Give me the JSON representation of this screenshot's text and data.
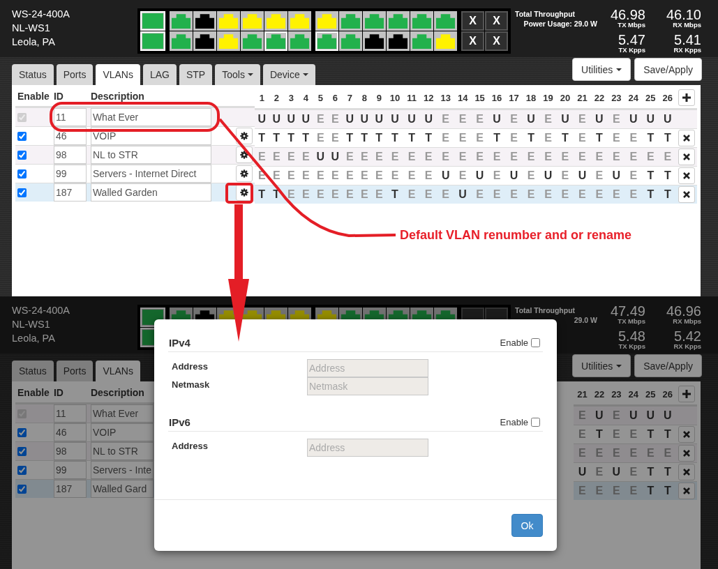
{
  "top": {
    "device": [
      "WS-24-400A",
      "NL-WS1",
      "Leola, PA"
    ],
    "port_panel": {
      "groups": [
        {
          "kind": "sfp",
          "top": [
            {
              "color": "#22b14c",
              "selected": true
            }
          ],
          "bottom": [
            {
              "color": "#22b14c",
              "selected": true
            }
          ]
        },
        {
          "kind": "rj45",
          "top": [
            {
              "color": "#22b14c",
              "selected": false
            },
            {
              "color": "#000000",
              "selected": false
            },
            {
              "color": "#fff200",
              "selected": false
            },
            {
              "color": "#fff200",
              "selected": false
            },
            {
              "color": "#fff200",
              "selected": false
            },
            {
              "color": "#fff200",
              "selected": false
            }
          ],
          "bottom": [
            {
              "color": "#22b14c",
              "selected": false
            },
            {
              "color": "#000000",
              "selected": false
            },
            {
              "color": "#fff200",
              "selected": false
            },
            {
              "color": "#22b14c",
              "selected": false
            },
            {
              "color": "#22b14c",
              "selected": true
            },
            {
              "color": "#22b14c",
              "selected": false
            }
          ]
        },
        {
          "kind": "rj45",
          "top": [
            {
              "color": "#fff200",
              "selected": false
            },
            {
              "color": "#22b14c",
              "selected": false
            },
            {
              "color": "#22b14c",
              "selected": false
            },
            {
              "color": "#22b14c",
              "selected": false
            },
            {
              "color": "#22b14c",
              "selected": false
            },
            {
              "color": "#22b14c",
              "selected": false
            }
          ],
          "bottom": [
            {
              "color": "#22b14c",
              "selected": true
            },
            {
              "color": "#22b14c",
              "selected": false
            },
            {
              "color": "#000000",
              "selected": false
            },
            {
              "color": "#000000",
              "selected": false
            },
            {
              "color": "#22b14c",
              "selected": false
            },
            {
              "color": "#fff200",
              "selected": false
            }
          ]
        }
      ],
      "blanks": [
        "X",
        "X",
        "X",
        "X"
      ]
    },
    "throughput": {
      "title": "Total Throughput",
      "power": "Power Usage: 29.0 W"
    },
    "readings": [
      {
        "value": "46.98",
        "unit": "TX Mbps"
      },
      {
        "value": "46.10",
        "unit": "RX Mbps"
      },
      {
        "value": "5.47",
        "unit": "TX Kpps"
      },
      {
        "value": "5.41",
        "unit": "RX Kpps"
      }
    ],
    "tabs": [
      {
        "label": "Status",
        "selected": false,
        "dropdown": false
      },
      {
        "label": "Ports",
        "selected": false,
        "dropdown": false
      },
      {
        "label": "VLANs",
        "selected": true,
        "dropdown": false
      },
      {
        "label": "LAG",
        "selected": false,
        "dropdown": false
      },
      {
        "label": "STP",
        "selected": false,
        "dropdown": false
      },
      {
        "label": "Tools",
        "selected": false,
        "dropdown": true
      },
      {
        "label": "Device",
        "selected": false,
        "dropdown": true
      }
    ],
    "actions": [
      {
        "label": "Utilities",
        "dropdown": true
      },
      {
        "label": "Save/Apply",
        "dropdown": false
      }
    ],
    "table": {
      "headers": [
        "Enable",
        "ID",
        "Description"
      ],
      "port_columns": [
        "1",
        "2",
        "3",
        "4",
        "5",
        "6",
        "7",
        "8",
        "9",
        "10",
        "11",
        "12",
        "13",
        "14",
        "15",
        "16",
        "17",
        "18",
        "19",
        "20",
        "21",
        "22",
        "23",
        "24",
        "25",
        "26"
      ],
      "rows": [
        {
          "enabled": true,
          "locked": true,
          "settings": false,
          "selected": false,
          "id": "11",
          "description": "What Ever",
          "ports": [
            {
              "mode": "U",
              "active": true
            },
            {
              "mode": "U",
              "active": true
            },
            {
              "mode": "U",
              "active": true
            },
            {
              "mode": "U",
              "active": true
            },
            {
              "mode": "E",
              "active": false
            },
            {
              "mode": "E",
              "active": false
            },
            {
              "mode": "U",
              "active": true
            },
            {
              "mode": "U",
              "active": true
            },
            {
              "mode": "U",
              "active": true
            },
            {
              "mode": "U",
              "active": true
            },
            {
              "mode": "U",
              "active": true
            },
            {
              "mode": "U",
              "active": true
            },
            {
              "mode": "E",
              "active": false
            },
            {
              "mode": "E",
              "active": false
            },
            {
              "mode": "E",
              "active": false
            },
            {
              "mode": "U",
              "active": true
            },
            {
              "mode": "E",
              "active": false
            },
            {
              "mode": "U",
              "active": true
            },
            {
              "mode": "E",
              "active": false
            },
            {
              "mode": "U",
              "active": true
            },
            {
              "mode": "E",
              "active": false
            },
            {
              "mode": "U",
              "active": true
            },
            {
              "mode": "E",
              "active": false
            },
            {
              "mode": "U",
              "active": true
            },
            {
              "mode": "U",
              "active": true
            },
            {
              "mode": "U",
              "active": true
            }
          ]
        },
        {
          "enabled": true,
          "locked": false,
          "settings": true,
          "selected": false,
          "id": "46",
          "description": "VOIP",
          "ports": [
            {
              "mode": "T",
              "active": true
            },
            {
              "mode": "T",
              "active": true
            },
            {
              "mode": "T",
              "active": true
            },
            {
              "mode": "T",
              "active": true
            },
            {
              "mode": "E",
              "active": false
            },
            {
              "mode": "E",
              "active": false
            },
            {
              "mode": "T",
              "active": true
            },
            {
              "mode": "T",
              "active": true
            },
            {
              "mode": "T",
              "active": true
            },
            {
              "mode": "T",
              "active": true
            },
            {
              "mode": "T",
              "active": true
            },
            {
              "mode": "T",
              "active": true
            },
            {
              "mode": "E",
              "active": false
            },
            {
              "mode": "E",
              "active": false
            },
            {
              "mode": "E",
              "active": false
            },
            {
              "mode": "T",
              "active": true
            },
            {
              "mode": "E",
              "active": false
            },
            {
              "mode": "T",
              "active": true
            },
            {
              "mode": "E",
              "active": false
            },
            {
              "mode": "T",
              "active": true
            },
            {
              "mode": "E",
              "active": false
            },
            {
              "mode": "T",
              "active": true
            },
            {
              "mode": "E",
              "active": false
            },
            {
              "mode": "E",
              "active": false
            },
            {
              "mode": "T",
              "active": true
            },
            {
              "mode": "T",
              "active": true
            }
          ]
        },
        {
          "enabled": true,
          "locked": false,
          "settings": true,
          "selected": false,
          "id": "98",
          "description": "NL to STR",
          "ports": [
            {
              "mode": "E",
              "active": false
            },
            {
              "mode": "E",
              "active": false
            },
            {
              "mode": "E",
              "active": false
            },
            {
              "mode": "E",
              "active": false
            },
            {
              "mode": "U",
              "active": true
            },
            {
              "mode": "U",
              "active": true
            },
            {
              "mode": "E",
              "active": false
            },
            {
              "mode": "E",
              "active": false
            },
            {
              "mode": "E",
              "active": false
            },
            {
              "mode": "E",
              "active": false
            },
            {
              "mode": "E",
              "active": false
            },
            {
              "mode": "E",
              "active": false
            },
            {
              "mode": "E",
              "active": false
            },
            {
              "mode": "E",
              "active": false
            },
            {
              "mode": "E",
              "active": false
            },
            {
              "mode": "E",
              "active": false
            },
            {
              "mode": "E",
              "active": false
            },
            {
              "mode": "E",
              "active": false
            },
            {
              "mode": "E",
              "active": false
            },
            {
              "mode": "E",
              "active": false
            },
            {
              "mode": "E",
              "active": false
            },
            {
              "mode": "E",
              "active": false
            },
            {
              "mode": "E",
              "active": false
            },
            {
              "mode": "E",
              "active": false
            },
            {
              "mode": "E",
              "active": false
            },
            {
              "mode": "E",
              "active": false
            }
          ]
        },
        {
          "enabled": true,
          "locked": false,
          "settings": true,
          "selected": false,
          "id": "99",
          "description": "Servers - Internet Direct",
          "ports": [
            {
              "mode": "E",
              "active": false
            },
            {
              "mode": "E",
              "active": false
            },
            {
              "mode": "E",
              "active": false
            },
            {
              "mode": "E",
              "active": false
            },
            {
              "mode": "E",
              "active": false
            },
            {
              "mode": "E",
              "active": false
            },
            {
              "mode": "E",
              "active": false
            },
            {
              "mode": "E",
              "active": false
            },
            {
              "mode": "E",
              "active": false
            },
            {
              "mode": "E",
              "active": false
            },
            {
              "mode": "E",
              "active": false
            },
            {
              "mode": "E",
              "active": false
            },
            {
              "mode": "U",
              "active": true
            },
            {
              "mode": "E",
              "active": false
            },
            {
              "mode": "U",
              "active": true
            },
            {
              "mode": "E",
              "active": false
            },
            {
              "mode": "U",
              "active": true
            },
            {
              "mode": "E",
              "active": false
            },
            {
              "mode": "U",
              "active": true
            },
            {
              "mode": "E",
              "active": false
            },
            {
              "mode": "U",
              "active": true
            },
            {
              "mode": "E",
              "active": false
            },
            {
              "mode": "U",
              "active": true
            },
            {
              "mode": "E",
              "active": false
            },
            {
              "mode": "T",
              "active": true
            },
            {
              "mode": "T",
              "active": true
            }
          ]
        },
        {
          "enabled": true,
          "locked": false,
          "settings": true,
          "selected": true,
          "id": "187",
          "description": "Walled Garden",
          "ports": [
            {
              "mode": "T",
              "active": true
            },
            {
              "mode": "T",
              "active": true
            },
            {
              "mode": "E",
              "active": false
            },
            {
              "mode": "E",
              "active": false
            },
            {
              "mode": "E",
              "active": false
            },
            {
              "mode": "E",
              "active": false
            },
            {
              "mode": "E",
              "active": false
            },
            {
              "mode": "E",
              "active": false
            },
            {
              "mode": "E",
              "active": false
            },
            {
              "mode": "T",
              "active": true
            },
            {
              "mode": "E",
              "active": false
            },
            {
              "mode": "E",
              "active": false
            },
            {
              "mode": "E",
              "active": false
            },
            {
              "mode": "U",
              "active": true
            },
            {
              "mode": "E",
              "active": false
            },
            {
              "mode": "E",
              "active": false
            },
            {
              "mode": "E",
              "active": false
            },
            {
              "mode": "E",
              "active": false
            },
            {
              "mode": "E",
              "active": false
            },
            {
              "mode": "E",
              "active": false
            },
            {
              "mode": "E",
              "active": false
            },
            {
              "mode": "E",
              "active": false
            },
            {
              "mode": "E",
              "active": false
            },
            {
              "mode": "E",
              "active": false
            },
            {
              "mode": "T",
              "active": true
            },
            {
              "mode": "T",
              "active": true
            }
          ]
        }
      ]
    }
  },
  "bottom": {
    "device": [
      "WS-24-400A",
      "NL-WS1",
      "Leola, PA"
    ],
    "throughput": {
      "title": "Total Throughput",
      "power": "29.0 W"
    },
    "readings": [
      {
        "value": "47.49",
        "unit": "TX Mbps"
      },
      {
        "value": "46.96",
        "unit": "RX Mbps"
      },
      {
        "value": "5.48",
        "unit": "TX Kpps"
      },
      {
        "value": "5.42",
        "unit": "RX Kpps"
      }
    ],
    "tabs": [
      {
        "label": "Status",
        "selected": false,
        "dropdown": false
      },
      {
        "label": "Ports",
        "selected": false,
        "dropdown": false
      },
      {
        "label": "VLANs",
        "selected": true,
        "dropdown": false
      }
    ],
    "actions": [
      {
        "label": "Utilities",
        "dropdown": true
      },
      {
        "label": "Save/Apply",
        "dropdown": false
      }
    ],
    "table": {
      "headers": [
        "Enable",
        "ID",
        "Description"
      ],
      "port_columns": [
        "21",
        "22",
        "23",
        "24",
        "25",
        "26"
      ],
      "rows": [
        {
          "enabled": true,
          "locked": true,
          "selected": false,
          "id": "11",
          "description": "What Ever",
          "ports": [
            {
              "mode": "E",
              "active": false
            },
            {
              "mode": "U",
              "active": true
            },
            {
              "mode": "E",
              "active": false
            },
            {
              "mode": "U",
              "active": true
            },
            {
              "mode": "U",
              "active": true
            },
            {
              "mode": "U",
              "active": true
            }
          ]
        },
        {
          "enabled": true,
          "locked": false,
          "selected": false,
          "id": "46",
          "description": "VOIP",
          "ports": [
            {
              "mode": "E",
              "active": false
            },
            {
              "mode": "T",
              "active": true
            },
            {
              "mode": "E",
              "active": false
            },
            {
              "mode": "E",
              "active": false
            },
            {
              "mode": "T",
              "active": true
            },
            {
              "mode": "T",
              "active": true
            }
          ]
        },
        {
          "enabled": true,
          "locked": false,
          "selected": false,
          "id": "98",
          "description": "NL to STR",
          "ports": [
            {
              "mode": "E",
              "active": false
            },
            {
              "mode": "E",
              "active": false
            },
            {
              "mode": "E",
              "active": false
            },
            {
              "mode": "E",
              "active": false
            },
            {
              "mode": "E",
              "active": false
            },
            {
              "mode": "E",
              "active": false
            }
          ]
        },
        {
          "enabled": true,
          "locked": false,
          "selected": false,
          "id": "99",
          "description": "Servers - Inte",
          "ports": [
            {
              "mode": "U",
              "active": true
            },
            {
              "mode": "E",
              "active": false
            },
            {
              "mode": "U",
              "active": true
            },
            {
              "mode": "E",
              "active": false
            },
            {
              "mode": "T",
              "active": true
            },
            {
              "mode": "T",
              "active": true
            }
          ]
        },
        {
          "enabled": true,
          "locked": false,
          "selected": true,
          "id": "187",
          "description": "Walled Gard",
          "ports": [
            {
              "mode": "E",
              "active": false
            },
            {
              "mode": "E",
              "active": false
            },
            {
              "mode": "E",
              "active": false
            },
            {
              "mode": "E",
              "active": false
            },
            {
              "mode": "T",
              "active": true
            },
            {
              "mode": "T",
              "active": true
            }
          ]
        }
      ]
    },
    "modal": {
      "sections": [
        {
          "title": "IPv4",
          "enable_label": "Enable",
          "enabled": false,
          "fields": [
            {
              "label": "Address",
              "placeholder": "Address"
            },
            {
              "label": "Netmask",
              "placeholder": "Netmask"
            }
          ]
        },
        {
          "title": "IPv6",
          "enable_label": "Enable",
          "enabled": false,
          "fields": [
            {
              "label": "Address",
              "placeholder": "Address"
            }
          ]
        }
      ],
      "ok_button": "Ok"
    }
  },
  "annotation": {
    "text": "Default VLAN renumber and or rename"
  }
}
